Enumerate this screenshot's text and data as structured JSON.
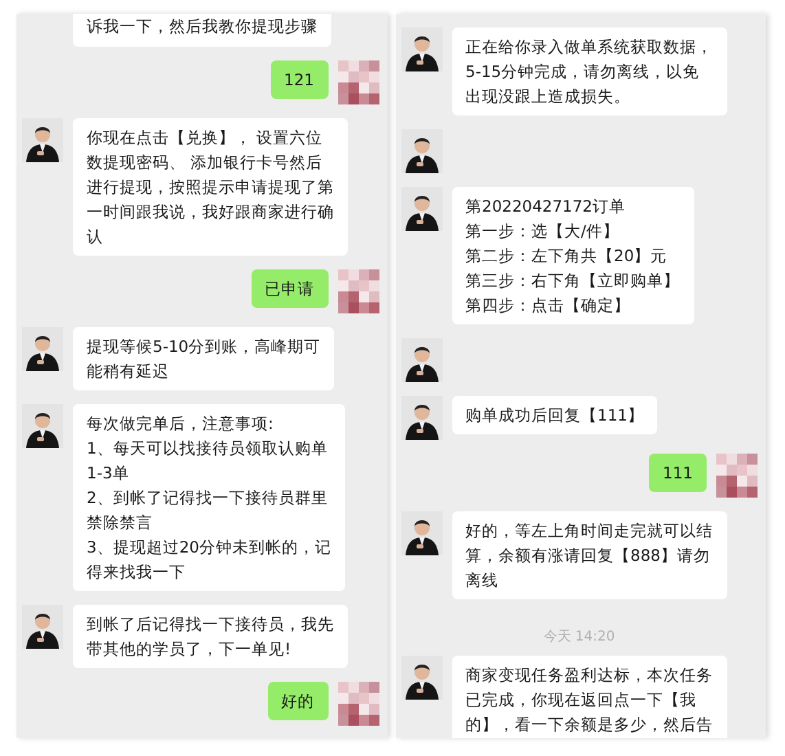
{
  "panels": [
    {
      "messages": [
        {
          "kind": "received_cut",
          "lines": [
            "诉我一下，然后我教你提现步骤"
          ]
        },
        {
          "kind": "sent",
          "lines": [
            "121"
          ]
        },
        {
          "kind": "received",
          "lines": [
            "你现在点击【兑换】， 设置六位",
            "数提现密码、 添加银行卡号然后",
            "进行提现，按照提示申请提现了第",
            "一时间跟我说，我好跟商家进行确",
            "认"
          ]
        },
        {
          "kind": "sent",
          "lines": [
            "已申请"
          ]
        },
        {
          "kind": "received",
          "lines": [
            "提现等候5-10分到账，高峰期可",
            "能稍有延迟"
          ]
        },
        {
          "kind": "received",
          "lines": [
            "每次做完单后，注意事项:",
            "1、每天可以找接待员领取认购单",
            "1-3单",
            "2、到帐了记得找一下接待员群里",
            "禁除禁言",
            "3、提现超过20分钟未到帐的，记",
            "得来找我一下"
          ]
        },
        {
          "kind": "received",
          "lines": [
            "到帐了后记得找一下接待员，我先",
            "带其他的学员了，下一单见!"
          ]
        },
        {
          "kind": "sent",
          "lines": [
            "好的"
          ]
        }
      ]
    },
    {
      "messages": [
        {
          "kind": "received",
          "lines": [
            "正在给你录入做单系统获取数据，",
            "5-15分钟完成，请勿离线，以免",
            "出现没跟上造成损失。"
          ]
        },
        {
          "kind": "avatar_only"
        },
        {
          "kind": "received",
          "lines": [
            "第20220427172订单",
            "第一步：选【大/件】",
            "第二步：左下角共【20】元",
            "第三步：右下角【立即购单】",
            "第四步：点击【确定】"
          ]
        },
        {
          "kind": "avatar_only"
        },
        {
          "kind": "received",
          "lines": [
            "购单成功后回复【111】"
          ]
        },
        {
          "kind": "sent",
          "lines": [
            "111"
          ]
        },
        {
          "kind": "received",
          "lines": [
            "好的，等左上角时间走完就可以结",
            "算，余额有涨请回复【888】请勿",
            "离线"
          ]
        },
        {
          "kind": "time",
          "text": "今天 14:20"
        },
        {
          "kind": "received",
          "lines": [
            "商家变现任务盈利达标，本次任务",
            "已完成，你现在返回点一下【我",
            "的】，看一下余额是多少，然后告"
          ]
        }
      ]
    }
  ]
}
